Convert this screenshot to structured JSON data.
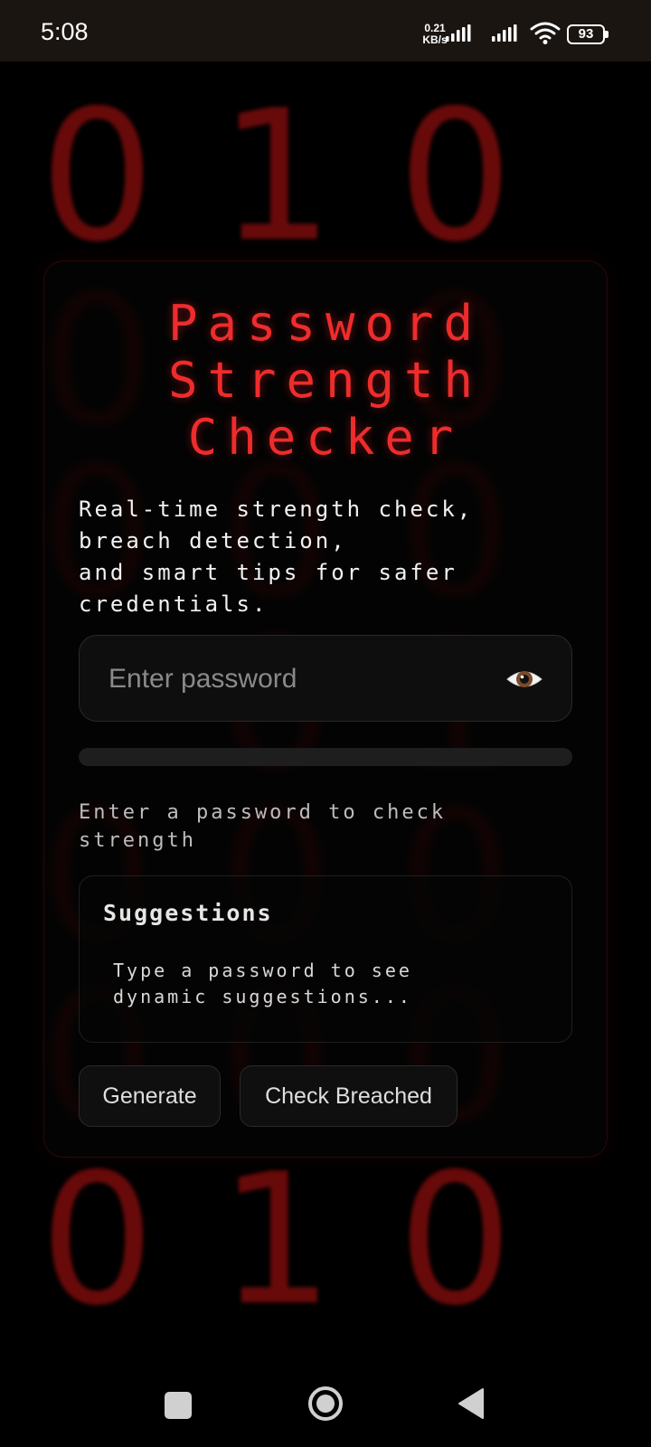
{
  "status_bar": {
    "time": "5:08",
    "net_speed_value": "0.21",
    "net_speed_unit": "KB/s",
    "battery_level": "93",
    "icons": [
      "signal-icon",
      "signal-icon",
      "wifi-icon",
      "battery-icon"
    ]
  },
  "background": {
    "top_digits": [
      "0",
      "1",
      "0"
    ],
    "bottom_digits": [
      "0",
      "1",
      "0"
    ],
    "accent_color": "#ee2c2c"
  },
  "app": {
    "title": "Password\nStrength\nChecker",
    "subtitle": "Real-time strength check,\nbreach detection,\nand smart tips for safer\ncredentials.",
    "password": {
      "value": "",
      "placeholder": "Enter password",
      "toggle_icon": "eye-icon"
    },
    "strength": {
      "fraction": 0,
      "message": "Enter a password to check\nstrength"
    },
    "suggestions": {
      "title": "Suggestions",
      "text": "Type a password to see\ndynamic suggestions..."
    },
    "buttons": {
      "generate_label": "Generate",
      "breached_label": "Check Breached"
    }
  },
  "nav_bar": {
    "icons": [
      "recents-icon",
      "home-icon",
      "back-icon"
    ]
  }
}
